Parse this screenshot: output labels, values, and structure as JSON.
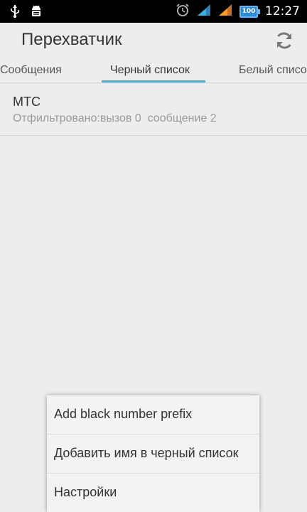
{
  "status_bar": {
    "time": "12:27",
    "battery": "100",
    "icons": [
      "usb-icon",
      "android-debug-icon",
      "alarm-icon",
      "signal-icon",
      "signal-icon",
      "battery-icon"
    ],
    "accent_color": "#33b5e5"
  },
  "action_bar": {
    "title": "Перехватчик",
    "refresh_icon": "refresh-icon"
  },
  "tabs": [
    {
      "label": "Сообщения"
    },
    {
      "label": "Черный список",
      "selected": true
    },
    {
      "label": "Белый список"
    }
  ],
  "list": [
    {
      "title": "МТС",
      "subtitle": "Отфильтровано:вызов 0  сообщение 2"
    }
  ],
  "menu": [
    {
      "label": "Add black number prefix"
    },
    {
      "label": "Добавить имя в черный список"
    },
    {
      "label": "Настройки"
    }
  ]
}
